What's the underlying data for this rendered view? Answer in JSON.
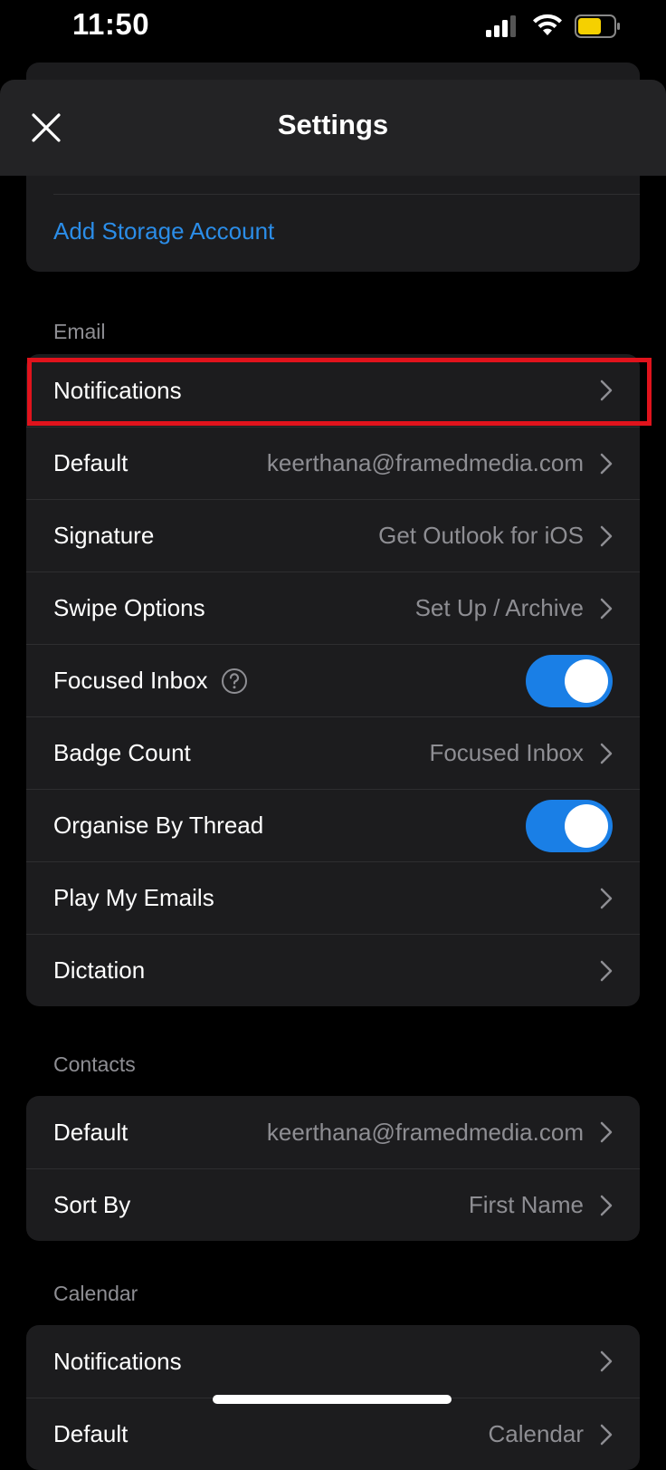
{
  "status_bar": {
    "time": "11:50",
    "icons": [
      "signal-icon",
      "wifi-icon",
      "battery-icon"
    ],
    "battery_color": "#f5d000"
  },
  "header": {
    "title": "Settings",
    "close_icon": "close-icon"
  },
  "storage": {
    "add_account_label": "Add Storage Account"
  },
  "email": {
    "section_label": "Email",
    "rows": {
      "notifications": {
        "label": "Notifications"
      },
      "default": {
        "label": "Default",
        "value": "keerthana@framedmedia.com"
      },
      "signature": {
        "label": "Signature",
        "value": "Get Outlook for iOS"
      },
      "swipe_options": {
        "label": "Swipe Options",
        "value": "Set Up / Archive"
      },
      "focused_inbox": {
        "label": "Focused Inbox",
        "enabled": true
      },
      "badge_count": {
        "label": "Badge Count",
        "value": "Focused Inbox"
      },
      "organise_by_thread": {
        "label": "Organise By Thread",
        "enabled": true
      },
      "play_my_emails": {
        "label": "Play My Emails"
      },
      "dictation": {
        "label": "Dictation"
      }
    }
  },
  "contacts": {
    "section_label": "Contacts",
    "rows": {
      "default": {
        "label": "Default",
        "value": "keerthana@framedmedia.com"
      },
      "sort_by": {
        "label": "Sort By",
        "value": "First Name"
      }
    }
  },
  "calendar": {
    "section_label": "Calendar",
    "rows": {
      "notifications": {
        "label": "Notifications"
      },
      "default": {
        "label": "Default",
        "value": "Calendar"
      }
    }
  },
  "colors": {
    "accent": "#1a7fe6",
    "link": "#2b8de8",
    "highlight": "#e0131c"
  }
}
